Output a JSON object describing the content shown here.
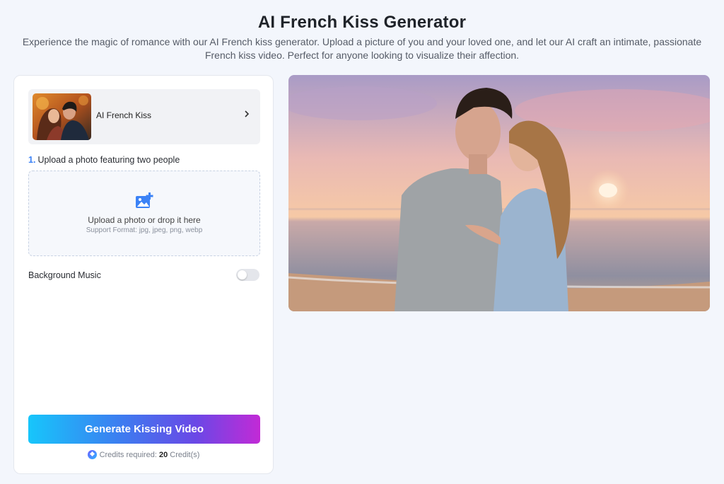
{
  "header": {
    "title": "AI French Kiss Generator",
    "subtitle": "Experience the magic of romance with our AI French kiss generator. Upload a picture of you and your loved one, and let our AI craft an intimate, passionate French kiss video. Perfect for anyone looking to visualize their affection."
  },
  "template": {
    "label": "AI French Kiss",
    "icon": "chevron-right-icon"
  },
  "upload": {
    "step_number": "1.",
    "step_label": "Upload a photo featuring two people",
    "icon": "add-image-icon",
    "text": "Upload a photo or drop it here",
    "hint": "Support Format: jpg, jpeg, png, webp"
  },
  "music": {
    "label": "Background Music",
    "enabled": false
  },
  "generate": {
    "label": "Generate Kissing Video"
  },
  "credits": {
    "prefix": "Credits required:",
    "count": "20",
    "suffix": "Credit(s)"
  },
  "colors": {
    "accent": "#3b82f6",
    "gradient_start": "#17c6fb",
    "gradient_end": "#c22ad6"
  }
}
